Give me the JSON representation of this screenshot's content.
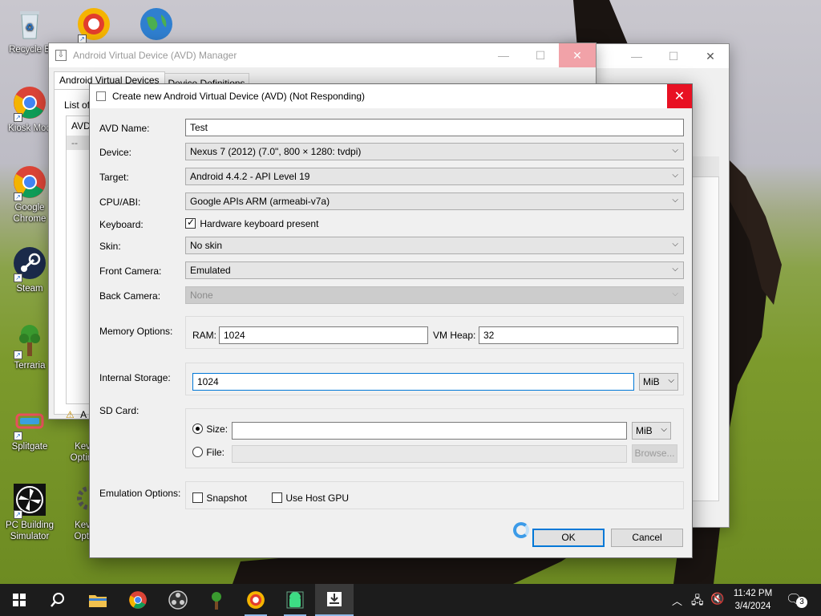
{
  "desktop": {
    "icons": [
      {
        "label": "Recycle B",
        "icon": "recycle-bin-icon"
      },
      {
        "label": "Kiosk Mod",
        "icon": "chrome-icon"
      },
      {
        "label": "Google",
        "label2": "Chrome",
        "icon": "chrome-icon"
      },
      {
        "label": "Steam",
        "icon": "steam-icon"
      },
      {
        "label": "Terraria",
        "icon": "terraria-icon"
      },
      {
        "label": "Splitgate",
        "icon": "splitgate-icon"
      },
      {
        "label": "PC Building",
        "label2": "Simulator",
        "icon": "pc-building-icon"
      },
      {
        "label": "Kev",
        "label2": "Optim",
        "icon": "gear-icon"
      },
      {
        "label": "Kev",
        "label2": "Opti",
        "icon": "gear-icon"
      }
    ]
  },
  "avd_manager": {
    "title": "Android Virtual Device (AVD) Manager",
    "tabs": [
      "Android Virtual Devices",
      "Device Definitions"
    ],
    "list_label": "List of",
    "list_col": "AVD",
    "list_row": "--",
    "warning": "A"
  },
  "dialog": {
    "title": "Create new Android Virtual Device (AVD) (Not Responding)",
    "avd_name": {
      "label": "AVD Name:",
      "value": "Test"
    },
    "device": {
      "label": "Device:",
      "value": "Nexus 7 (2012) (7.0\", 800 × 1280: tvdpi)"
    },
    "target": {
      "label": "Target:",
      "value": "Android 4.4.2 - API Level 19"
    },
    "cpu": {
      "label": "CPU/ABI:",
      "value": "Google APIs ARM (armeabi-v7a)"
    },
    "keyboard": {
      "label": "Keyboard:",
      "checkbox": "Hardware keyboard present"
    },
    "skin": {
      "label": "Skin:",
      "value": "No skin"
    },
    "front_camera": {
      "label": "Front Camera:",
      "value": "Emulated"
    },
    "back_camera": {
      "label": "Back Camera:",
      "value": "None"
    },
    "memory": {
      "label": "Memory Options:",
      "ram_label": "RAM:",
      "ram": "1024",
      "heap_label": "VM Heap:",
      "heap": "32"
    },
    "storage": {
      "label": "Internal Storage:",
      "value": "1024",
      "unit": "MiB"
    },
    "sdcard": {
      "label": "SD Card:",
      "size_label": "Size:",
      "size": "",
      "size_unit": "MiB",
      "file_label": "File:",
      "browse": "Browse..."
    },
    "emulation": {
      "label": "Emulation Options:",
      "snapshot": "Snapshot",
      "host_gpu": "Use Host GPU"
    },
    "ok": "OK",
    "cancel": "Cancel"
  },
  "taskbar": {
    "time": "11:42 PM",
    "date": "3/4/2024",
    "notifications": "3"
  },
  "colors": {
    "accent": "#0078d7",
    "close_red": "#e81123",
    "taskbar": "#1c1c1c"
  }
}
